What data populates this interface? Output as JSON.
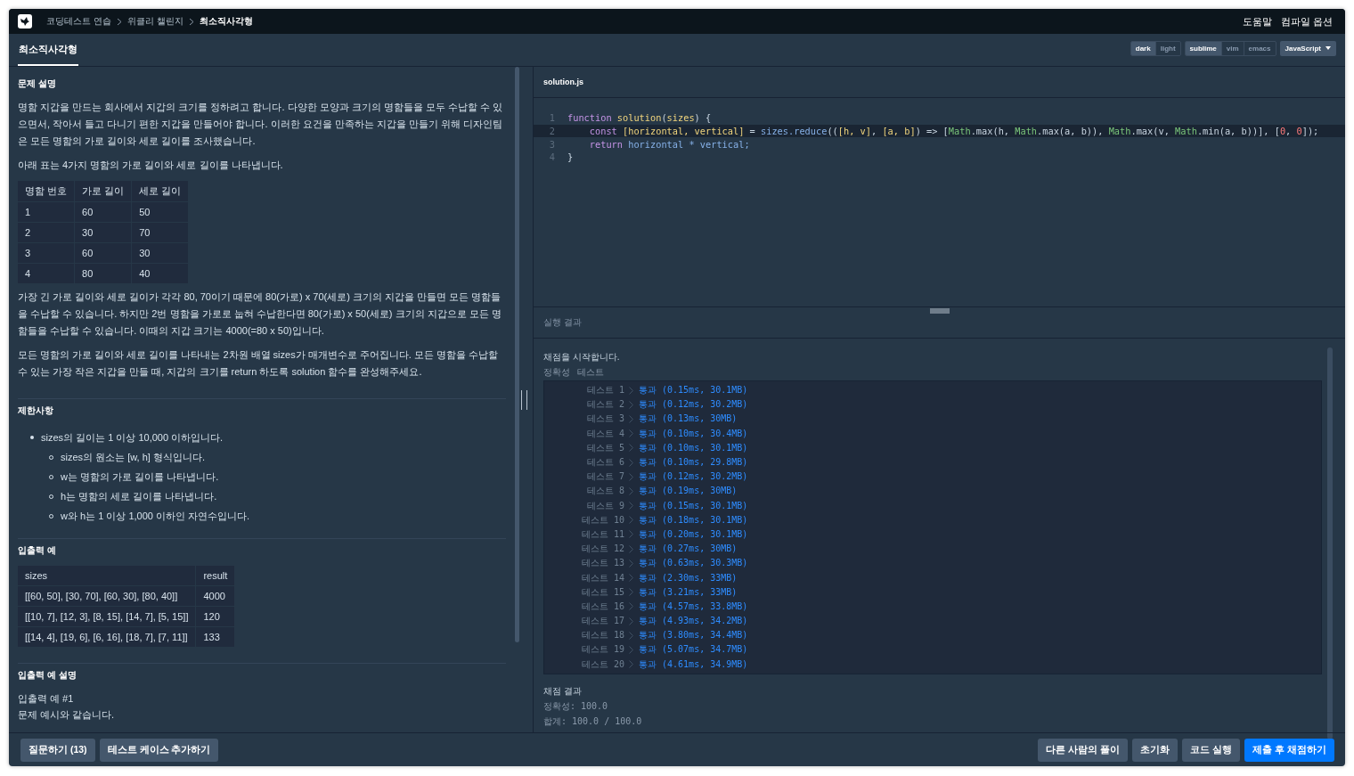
{
  "top_bar": {
    "breadcrumb": [
      {
        "label": "코딩테스트 연습",
        "current": false
      },
      {
        "label": "위클리 챌린지",
        "current": false
      },
      {
        "label": "최소직사각형",
        "current": true
      }
    ],
    "links": [
      "도움말",
      "컴파일 옵션"
    ]
  },
  "tabs": [
    {
      "label": "최소직사각형",
      "selected": true
    }
  ],
  "editor_options": {
    "groups": [
      [
        {
          "label": "dark",
          "selected": true
        },
        {
          "label": "light",
          "selected": false
        }
      ],
      [
        {
          "label": "sublime",
          "selected": true
        },
        {
          "label": "vim",
          "selected": false
        },
        {
          "label": "emacs",
          "selected": false
        }
      ]
    ],
    "language": "JavaScript"
  },
  "description": {
    "sections": [
      {
        "title": "문제 설명",
        "blocks": [
          {
            "kind": "paragraph",
            "text": "명함 지갑을 만드는 회사에서 지갑의 크기를 정하려고 합니다. 다양한 모양과 크기의 명함들을 모두 수납할 수 있으면서, 작아서 들고 다니기 편한 지갑을 만들어야 합니다. 이러한 요건을 만족하는 지갑을 만들기 위해 디자인팀은 모든 명함의 가로 길이와 세로 길이를 조사했습니다."
          },
          {
            "kind": "paragraph",
            "text": "아래 표는 4가지 명함의 가로 길이와 세로 길이를 나타냅니다."
          },
          {
            "kind": "table",
            "header": [
              "명함 번호",
              "가로 길이",
              "세로 길이"
            ],
            "rows": [
              [
                "1",
                "60",
                "50"
              ],
              [
                "2",
                "30",
                "70"
              ],
              [
                "3",
                "60",
                "30"
              ],
              [
                "4",
                "80",
                "40"
              ]
            ]
          },
          {
            "kind": "paragraph",
            "text": "가장 긴 가로 길이와 세로 길이가 각각 80, 70이기 때문에 80(가로) x 70(세로) 크기의 지갑을 만들면 모든 명함들을 수납할 수 있습니다. 하지만 2번 명함을 가로로 눕혀 수납한다면 80(가로) x 50(세로) 크기의 지갑으로 모든 명함들을 수납할 수 있습니다. 이때의 지갑 크기는 4000(=80 x 50)입니다."
          },
          {
            "kind": "paragraph",
            "text": "모든 명함의 가로 길이와 세로 길이를 나타내는 2차원 배열 sizes가 매개변수로 주어집니다. 모든 명함을 수납할 수 있는 가장 작은 지갑을 만들 때, 지갑의 크기를 return 하도록 solution 함수를 완성해주세요."
          }
        ]
      },
      {
        "title": "제한사항",
        "blocks": [
          {
            "kind": "list",
            "items": [
              {
                "text": "sizes의 길이는 1 이상 10,000 이하입니다.",
                "children": [
                  {
                    "text": "sizes의 원소는 [w, h] 형식입니다."
                  },
                  {
                    "text": "w는 명함의 가로 길이를 나타냅니다."
                  },
                  {
                    "text": "h는 명함의 세로 길이를 나타냅니다."
                  },
                  {
                    "text": "w와 h는 1 이상 1,000 이하인 자연수입니다."
                  }
                ]
              }
            ]
          }
        ]
      },
      {
        "title": "입출력 예",
        "blocks": [
          {
            "kind": "table",
            "header": [
              "sizes",
              "result"
            ],
            "rows": [
              [
                "[[60, 50], [30, 70], [60, 30], [80, 40]]",
                "4000"
              ],
              [
                "[[10, 7], [12, 3], [8, 15], [14, 7], [5, 15]]",
                "120"
              ],
              [
                "[[14, 4], [19, 6], [6, 16], [18, 7], [7, 11]]",
                "133"
              ]
            ]
          }
        ]
      },
      {
        "title": "입출력 예 설명",
        "blocks": [
          {
            "kind": "line",
            "text": "입출력 예 #1"
          },
          {
            "kind": "line",
            "text": "문제 예시와 같습니다."
          }
        ]
      }
    ]
  },
  "editor": {
    "file": "solution.js",
    "lines": [
      {
        "number": "1",
        "active": false,
        "tokens": [
          {
            "text": "function",
            "kind": "keyword"
          },
          {
            "text": " solution",
            "kind": "def"
          },
          {
            "text": "(",
            "kind": "plain"
          },
          {
            "text": "sizes",
            "kind": "def"
          },
          {
            "text": ") {",
            "kind": "plain"
          }
        ]
      },
      {
        "number": "2",
        "active": true,
        "tokens": [
          {
            "text": "    const",
            "kind": "keyword"
          },
          {
            "text": " [horizontal, vertical]",
            "kind": "def"
          },
          {
            "text": " = ",
            "kind": "plain"
          },
          {
            "text": "sizes.reduce",
            "kind": "var"
          },
          {
            "text": "((",
            "kind": "plain"
          },
          {
            "text": "[h, v]",
            "kind": "def"
          },
          {
            "text": ", ",
            "kind": "plain"
          },
          {
            "text": "[a, b]",
            "kind": "def"
          },
          {
            "text": ") => [",
            "kind": "plain"
          },
          {
            "text": "Math",
            "kind": "builtin"
          },
          {
            "text": ".max(h, ",
            "kind": "plain"
          },
          {
            "text": "Math",
            "kind": "builtin"
          },
          {
            "text": ".max(a, b)), ",
            "kind": "plain"
          },
          {
            "text": "Math",
            "kind": "builtin"
          },
          {
            "text": ".max(v, ",
            "kind": "plain"
          },
          {
            "text": "Math",
            "kind": "builtin"
          },
          {
            "text": ".min(a, b))], [",
            "kind": "plain"
          },
          {
            "text": "0",
            "kind": "number"
          },
          {
            "text": ", ",
            "kind": "plain"
          },
          {
            "text": "0",
            "kind": "number"
          },
          {
            "text": "]);",
            "kind": "plain"
          }
        ]
      },
      {
        "number": "3",
        "active": false,
        "tokens": [
          {
            "text": "    return",
            "kind": "keyword"
          },
          {
            "text": " horizontal * vertical;",
            "kind": "var"
          }
        ]
      },
      {
        "number": "4",
        "active": false,
        "tokens": [
          {
            "text": "}",
            "kind": "plain"
          }
        ]
      }
    ]
  },
  "results": {
    "title": "실행 결과",
    "start": "채점을 시작합니다.",
    "labels": [
      "정확성",
      "테스트"
    ],
    "tests": [
      {
        "label": "테스트 1",
        "result": "통과 (0.15ms, 30.1MB)"
      },
      {
        "label": "테스트 2",
        "result": "통과 (0.12ms, 30.2MB)"
      },
      {
        "label": "테스트 3",
        "result": "통과 (0.13ms, 30MB)"
      },
      {
        "label": "테스트 4",
        "result": "통과 (0.10ms, 30.4MB)"
      },
      {
        "label": "테스트 5",
        "result": "통과 (0.10ms, 30.1MB)"
      },
      {
        "label": "테스트 6",
        "result": "통과 (0.10ms, 29.8MB)"
      },
      {
        "label": "테스트 7",
        "result": "통과 (0.12ms, 30.2MB)"
      },
      {
        "label": "테스트 8",
        "result": "통과 (0.19ms, 30MB)"
      },
      {
        "label": "테스트 9",
        "result": "통과 (0.15ms, 30.1MB)"
      },
      {
        "label": "테스트 10",
        "result": "통과 (0.18ms, 30.1MB)"
      },
      {
        "label": "테스트 11",
        "result": "통과 (0.20ms, 30.1MB)"
      },
      {
        "label": "테스트 12",
        "result": "통과 (0.27ms, 30MB)"
      },
      {
        "label": "테스트 13",
        "result": "통과 (0.63ms, 30.3MB)"
      },
      {
        "label": "테스트 14",
        "result": "통과 (2.30ms, 33MB)"
      },
      {
        "label": "테스트 15",
        "result": "통과 (3.21ms, 33MB)"
      },
      {
        "label": "테스트 16",
        "result": "통과 (4.57ms, 33.8MB)"
      },
      {
        "label": "테스트 17",
        "result": "통과 (4.93ms, 34.2MB)"
      },
      {
        "label": "테스트 18",
        "result": "통과 (3.80ms, 34.4MB)"
      },
      {
        "label": "테스트 19",
        "result": "통과 (5.07ms, 34.7MB)"
      },
      {
        "label": "테스트 20",
        "result": "통과 (4.61ms, 34.9MB)"
      }
    ],
    "summary_title": "채점 결과",
    "summary": [
      "정확성: 100.0",
      "합계: 100.0 / 100.0"
    ]
  },
  "bottom_bar": {
    "left": [
      {
        "label": "질문하기 (13)",
        "kind": "default"
      },
      {
        "label": "테스트 케이스 추가하기",
        "kind": "default"
      }
    ],
    "right": [
      {
        "label": "다른 사람의 풀이",
        "kind": "default"
      },
      {
        "label": "초기화",
        "kind": "default"
      },
      {
        "label": "코드 실행",
        "kind": "default"
      },
      {
        "label": "제출 후 채점하기",
        "kind": "primary"
      }
    ]
  }
}
